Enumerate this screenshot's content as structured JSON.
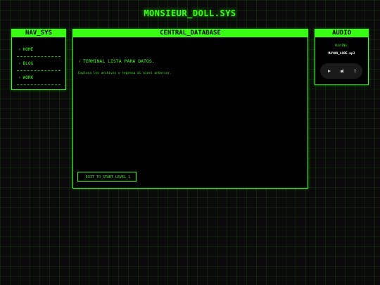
{
  "site": {
    "title": "MONSIEUR_DOLL.SYS"
  },
  "nav": {
    "header": "NAV_SYS",
    "items": [
      {
        "label": "HOME"
      },
      {
        "label": "BLOG"
      },
      {
        "label": "WORK"
      }
    ]
  },
  "central": {
    "header": "CENTRAL_DATABASE",
    "heading": "TERMINAL LISTA PARA DATOS.",
    "text": "Explora los archivos o regresa al nivel anterior.",
    "exit_label": "_EXIT_TO_START_LEVEL_1"
  },
  "audio": {
    "header": "AUDIO",
    "status": "PLAYING:",
    "track": "MAYAN_LORE.mp3",
    "controls": {
      "play_icon": "play-icon",
      "volume_icon": "volume-icon",
      "more_icon": "more-options-icon"
    }
  },
  "colors": {
    "accent": "#39ff14",
    "background": "#0a0a0a",
    "panel": "#000000"
  },
  "icons": {
    "chevron": "›"
  }
}
